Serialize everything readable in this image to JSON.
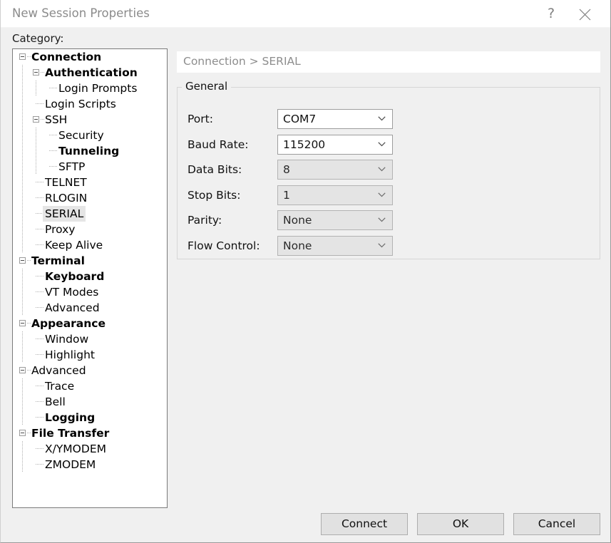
{
  "window": {
    "title": "New Session Properties",
    "help_icon": "question-mark-icon",
    "close_icon": "close-x-icon"
  },
  "category": {
    "label": "Category:",
    "selected": "SERIAL",
    "tree": [
      {
        "label": "Connection",
        "depth": 0,
        "bold": true,
        "expander": true,
        "selected": false
      },
      {
        "label": "Authentication",
        "depth": 1,
        "bold": true,
        "expander": true,
        "selected": false
      },
      {
        "label": "Login Prompts",
        "depth": 2,
        "bold": false,
        "expander": false,
        "selected": false
      },
      {
        "label": "Login Scripts",
        "depth": 1,
        "bold": false,
        "expander": false,
        "selected": false
      },
      {
        "label": "SSH",
        "depth": 1,
        "bold": false,
        "expander": true,
        "selected": false
      },
      {
        "label": "Security",
        "depth": 2,
        "bold": false,
        "expander": false,
        "selected": false
      },
      {
        "label": "Tunneling",
        "depth": 2,
        "bold": true,
        "expander": false,
        "selected": false
      },
      {
        "label": "SFTP",
        "depth": 2,
        "bold": false,
        "expander": false,
        "selected": false
      },
      {
        "label": "TELNET",
        "depth": 1,
        "bold": false,
        "expander": false,
        "selected": false
      },
      {
        "label": "RLOGIN",
        "depth": 1,
        "bold": false,
        "expander": false,
        "selected": false
      },
      {
        "label": "SERIAL",
        "depth": 1,
        "bold": false,
        "expander": false,
        "selected": true
      },
      {
        "label": "Proxy",
        "depth": 1,
        "bold": false,
        "expander": false,
        "selected": false
      },
      {
        "label": "Keep Alive",
        "depth": 1,
        "bold": false,
        "expander": false,
        "selected": false
      },
      {
        "label": "Terminal",
        "depth": 0,
        "bold": true,
        "expander": true,
        "selected": false
      },
      {
        "label": "Keyboard",
        "depth": 1,
        "bold": true,
        "expander": false,
        "selected": false
      },
      {
        "label": "VT Modes",
        "depth": 1,
        "bold": false,
        "expander": false,
        "selected": false
      },
      {
        "label": "Advanced",
        "depth": 1,
        "bold": false,
        "expander": false,
        "selected": false
      },
      {
        "label": "Appearance",
        "depth": 0,
        "bold": true,
        "expander": true,
        "selected": false
      },
      {
        "label": "Window",
        "depth": 1,
        "bold": false,
        "expander": false,
        "selected": false
      },
      {
        "label": "Highlight",
        "depth": 1,
        "bold": false,
        "expander": false,
        "selected": false
      },
      {
        "label": "Advanced",
        "depth": 0,
        "bold": false,
        "expander": true,
        "selected": false
      },
      {
        "label": "Trace",
        "depth": 1,
        "bold": false,
        "expander": false,
        "selected": false
      },
      {
        "label": "Bell",
        "depth": 1,
        "bold": false,
        "expander": false,
        "selected": false
      },
      {
        "label": "Logging",
        "depth": 1,
        "bold": true,
        "expander": false,
        "selected": false
      },
      {
        "label": "File Transfer",
        "depth": 0,
        "bold": true,
        "expander": true,
        "selected": false
      },
      {
        "label": "X/YMODEM",
        "depth": 1,
        "bold": false,
        "expander": false,
        "selected": false
      },
      {
        "label": "ZMODEM",
        "depth": 1,
        "bold": false,
        "expander": false,
        "selected": false
      }
    ]
  },
  "content": {
    "breadcrumb": "Connection > SERIAL",
    "group_title": "General",
    "fields": [
      {
        "name": "port",
        "label": "Port:",
        "value": "COM7",
        "enabled": true
      },
      {
        "name": "baud-rate",
        "label": "Baud Rate:",
        "value": "115200",
        "enabled": true
      },
      {
        "name": "data-bits",
        "label": "Data Bits:",
        "value": "8",
        "enabled": false
      },
      {
        "name": "stop-bits",
        "label": "Stop Bits:",
        "value": "1",
        "enabled": false
      },
      {
        "name": "parity",
        "label": "Parity:",
        "value": "None",
        "enabled": false
      },
      {
        "name": "flow-control",
        "label": "Flow Control:",
        "value": "None",
        "enabled": false
      }
    ]
  },
  "footer": {
    "connect_label": "Connect",
    "ok_label": "OK",
    "cancel_label": "Cancel"
  },
  "colors": {
    "dialog_background": "#f0f0f0",
    "titlebar_background": "#ffffff",
    "title_text": "#8b8b8b",
    "breadcrumb_text": "#8d8d8d",
    "tree_background": "#ffffff",
    "selection_highlight": "#e5e5e5",
    "button_face": "#e1e1e1",
    "disabled_field": "#e4e4e4"
  }
}
